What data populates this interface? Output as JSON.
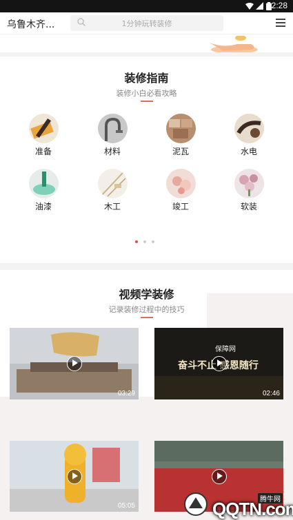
{
  "status_bar": {
    "time": "2:28"
  },
  "header": {
    "city": "乌鲁木齐...",
    "search_placeholder": "1分钟玩转装修"
  },
  "guide": {
    "title": "装修指南",
    "subtitle": "装修小白必看攻略",
    "items": [
      {
        "label": "准备",
        "icon": "preparation-icon"
      },
      {
        "label": "材料",
        "icon": "materials-icon"
      },
      {
        "label": "泥瓦",
        "icon": "masonry-icon"
      },
      {
        "label": "水电",
        "icon": "plumbing-electric-icon"
      },
      {
        "label": "油漆",
        "icon": "paint-icon"
      },
      {
        "label": "木工",
        "icon": "carpentry-icon"
      },
      {
        "label": "竣工",
        "icon": "completion-icon"
      },
      {
        "label": "软装",
        "icon": "soft-furnishing-icon"
      }
    ],
    "pager": {
      "pages": 3,
      "active": 1
    }
  },
  "video": {
    "title": "视频学装修",
    "subtitle": "记录装修过程中的技巧",
    "items": [
      {
        "duration": "03:29"
      },
      {
        "duration": "02:46",
        "overlay_brand": "保障网",
        "overlay_slogan": "奋斗不止 感恩随行"
      },
      {
        "duration": "05:05"
      },
      {
        "duration": ""
      }
    ]
  },
  "watermark": {
    "brand": "QQTN.com",
    "badge": "腾牛网"
  },
  "colors": {
    "accent_line": "#e36a5f",
    "pager_active": "#ee4444"
  }
}
